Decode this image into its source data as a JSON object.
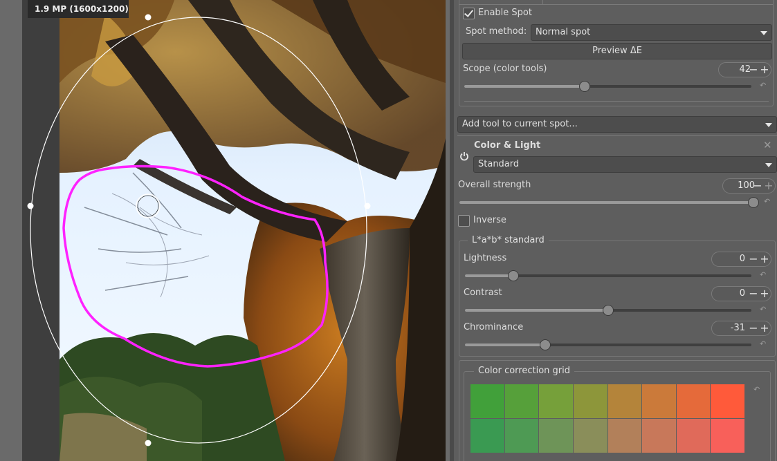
{
  "canvas": {
    "badge": "1.9 MP (1600x1200)"
  },
  "spot": {
    "enable_label": "Enable Spot",
    "enable_checked": true,
    "method_label": "Spot method:",
    "method_value": "Normal spot",
    "preview_label": "Preview ΔE",
    "scope_label": "Scope (color tools)",
    "scope_value": "42",
    "scope_fraction": 0.42
  },
  "add_tool": {
    "value": "Add tool to current spot..."
  },
  "color_light": {
    "title": "Color & Light",
    "mode_value": "Standard",
    "overall_label": "Overall strength",
    "overall_value": "100",
    "overall_fraction": 1.0,
    "inverse_label": "Inverse",
    "inverse_checked": false,
    "lab_legend": "L*a*b* standard",
    "lightness_label": "Lightness",
    "lightness_value": "0",
    "lightness_fraction": 0.17,
    "contrast_label": "Contrast",
    "contrast_value": "0",
    "contrast_fraction": 0.5,
    "chrominance_label": "Chrominance",
    "chrominance_value": "-31",
    "chrominance_fraction": 0.28,
    "grid_legend": "Color correction grid"
  },
  "grid_colors": [
    [
      "#41a03a",
      "#56a03a",
      "#76a03a",
      "#8d963a",
      "#b4843a",
      "#cb7a3a",
      "#e56a3a",
      "#ff5a3a"
    ],
    [
      "#3a9a52",
      "#4e9a54",
      "#6e9458",
      "#8a8e5a",
      "#b2805a",
      "#c8785a",
      "#e06a5a",
      "#f8605a"
    ]
  ],
  "colors": {
    "panel": "#5e5e5e",
    "mask_stroke": "#ff22ff",
    "ellipse_stroke": "#ffffff"
  },
  "icons": {
    "check": "check-icon",
    "dropdown": "chevron-down-icon",
    "reset": "reset-icon",
    "power": "power-icon",
    "close": "close-icon"
  }
}
